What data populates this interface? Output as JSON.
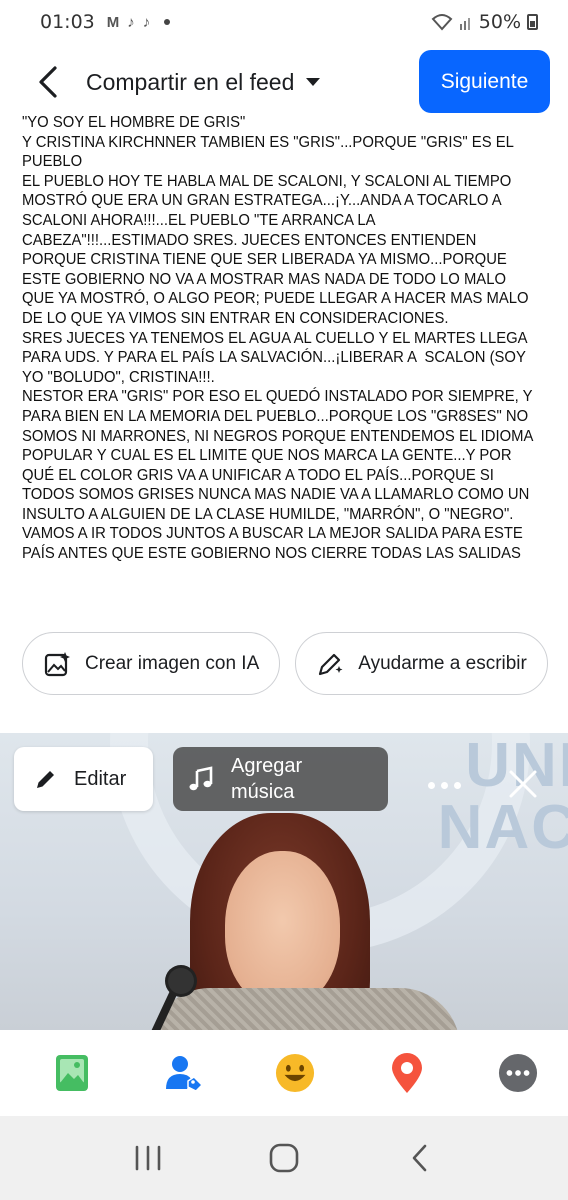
{
  "status_bar": {
    "time": "01:03",
    "notification_icons": [
      "gmail-icon",
      "tiktok-icon",
      "tiktok-icon"
    ],
    "battery": "50%"
  },
  "header": {
    "title": "Compartir en el feed",
    "next_label": "Siguiente",
    "accent": "#0866ff"
  },
  "post": {
    "text": "\"YO SOY EL HOMBRE DE GRIS\"\nY CRISTINA KIRCHNNER TAMBIEN ES \"GRIS\"...PORQUE \"GRIS\" ES EL PUEBLO\nEL PUEBLO HOY TE HABLA MAL DE SCALONI, Y SCALONI AL TIEMPO MOSTRÓ QUE ERA UN GRAN ESTRATEGA...¡Y...ANDA A TOCARLO A SCALONI AHORA!!!...EL PUEBLO \"TE ARRANCA LA CABEZA\"!!!...ESTIMADO SRES. JUECES ENTONCES ENTIENDEN PORQUE CRISTINA TIENE QUE SER LIBERADA YA MISMO...PORQUE ESTE GOBIERNO NO VA A MOSTRAR MAS NADA DE TODO LO MALO QUE YA MOSTRÓ, O ALGO PEOR; PUEDE LLEGAR A HACER MAS MALO DE LO QUE YA VIMOS SIN ENTRAR EN CONSIDERACIONES.\nSRES JUECES YA TENEMOS EL AGUA AL CUELLO Y EL MARTES LLEGA PARA UDS. Y PARA EL PAÍS LA SALVACIÓN...¡LIBERAR A  SCALON (SOY YO \"BOLUDO\", CRISTINA!!!.\nNESTOR ERA \"GRIS\" POR ESO EL QUEDÓ INSTALADO POR SIEMPRE, Y PARA BIEN EN LA MEMORIA DEL PUEBLO...PORQUE LOS \"GR8SES\" NO SOMOS NI MARRONES, NI NEGROS PORQUE ENTENDEMOS EL IDIOMA POPULAR Y CUAL ES EL LIMITE QUE NOS MARCA LA GENTE...Y POR QUÉ EL COLOR GRIS VA A UNIFICAR A TODO EL PAÍS...PORQUE SI TODOS SOMOS GRISES NUNCA MAS NADIE VA A LLAMARLO COMO UN INSULTO A ALGUIEN DE LA CLASE HUMILDE, \"MARRÓN\", O \"NEGRO\". VAMOS A IR TODOS JUNTOS A BUSCAR LA MEJOR SALIDA PARA ESTE PAÍS ANTES QUE ESTE GOBIERNO NOS CIERRE TODAS LAS SALIDAS"
  },
  "chips": {
    "ai_image": "Crear imagen con IA",
    "help_write": "Ayudarme a escribir"
  },
  "media": {
    "edit_label": "Editar",
    "music_label_line1": "Agregar",
    "music_label_line2": "música",
    "banner_text": "UNI\nNAC"
  },
  "action_bar": {
    "items": [
      "photo-icon",
      "tag-people-icon",
      "feeling-icon",
      "location-icon",
      "more-icon"
    ],
    "colors": {
      "photo": "#45bd62",
      "tag": "#1877f2",
      "feeling": "#f7b928",
      "location": "#f5533d",
      "more": "#65676b"
    }
  }
}
